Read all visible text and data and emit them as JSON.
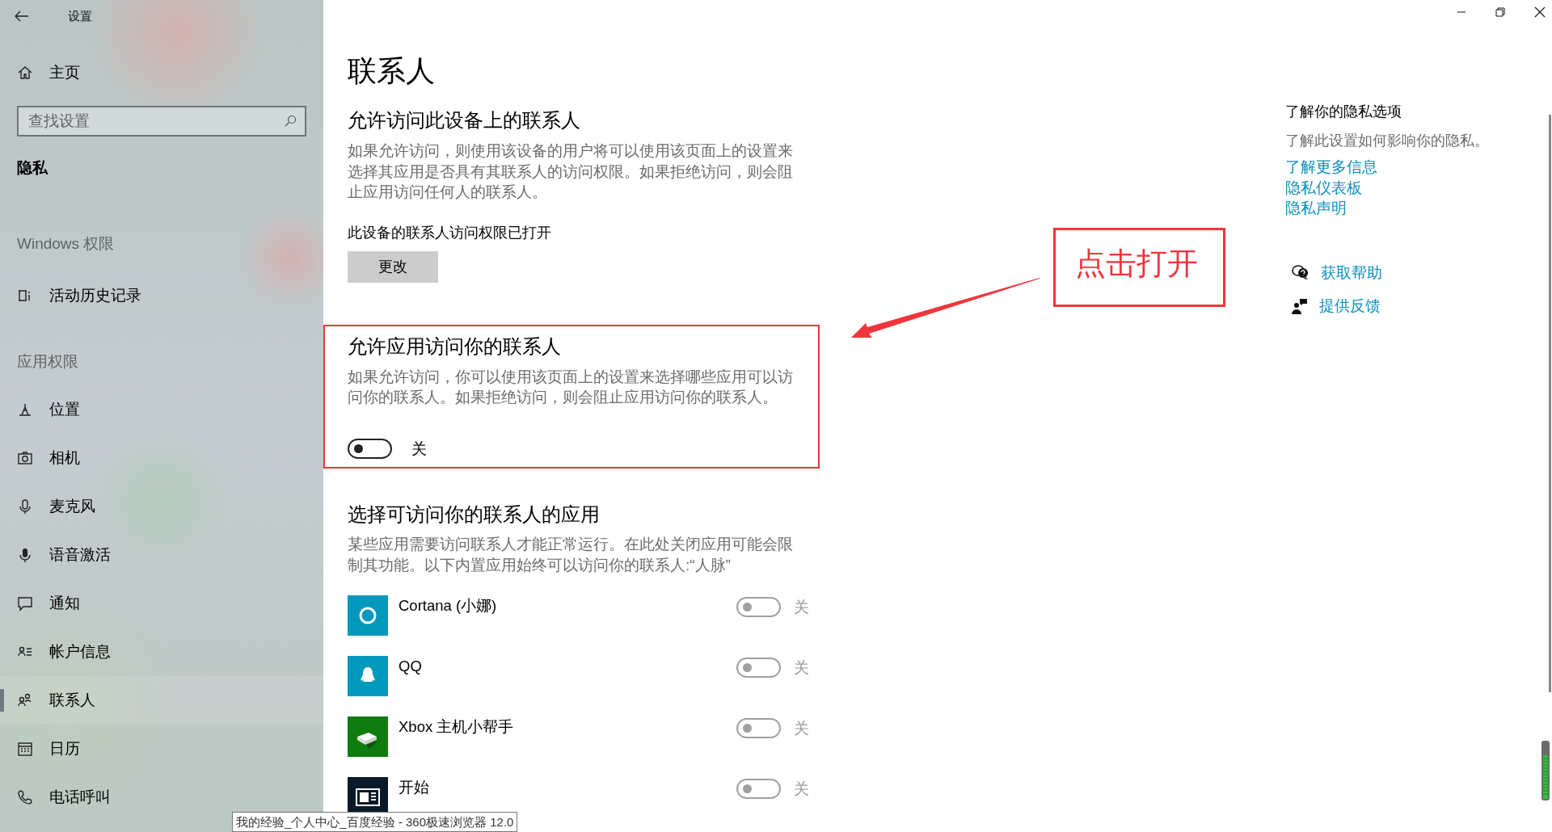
{
  "window": {
    "title": "设置"
  },
  "sidebar": {
    "home": "主页",
    "search": {
      "placeholder": "查找设置"
    },
    "section_title": "隐私",
    "groups": [
      {
        "heading": "Windows 权限",
        "items": [
          {
            "label": "活动历史记录",
            "kind": "activity",
            "selected": false
          }
        ]
      },
      {
        "heading": "应用权限",
        "items": [
          {
            "label": "位置",
            "kind": "location",
            "selected": false
          },
          {
            "label": "相机",
            "kind": "camera",
            "selected": false
          },
          {
            "label": "麦克风",
            "kind": "mic",
            "selected": false
          },
          {
            "label": "语音激活",
            "kind": "voice",
            "selected": false
          },
          {
            "label": "通知",
            "kind": "notification",
            "selected": false
          },
          {
            "label": "帐户信息",
            "kind": "account",
            "selected": false
          },
          {
            "label": "联系人",
            "kind": "contacts",
            "selected": true
          },
          {
            "label": "日历",
            "kind": "calendar",
            "selected": false
          },
          {
            "label": "电话呼叫",
            "kind": "phone",
            "selected": false
          }
        ]
      }
    ]
  },
  "page": {
    "title": "联系人",
    "device_access": {
      "heading": "允许访问此设备上的联系人",
      "description": "如果允许访问，则使用该设备的用户将可以使用该页面上的设置来选择其应用是否具有其联系人的访问权限。如果拒绝访问，则会阻止应用访问任何人的联系人。",
      "status": "此设备的联系人访问权限已打开",
      "button": "更改"
    },
    "app_access": {
      "heading": "允许应用访问你的联系人",
      "description": "如果允许访问，你可以使用该页面上的设置来选择哪些应用可以访问你的联系人。如果拒绝访问，则会阻止应用访问你的联系人。",
      "toggle": {
        "on": false,
        "state_label": "关"
      }
    },
    "app_list": {
      "heading": "选择可访问你的联系人的应用",
      "description": "某些应用需要访问联系人才能正常运行。在此处关闭应用可能会限制其功能。以下内置应用始终可以访问你的联系人:“人脉”",
      "apps": [
        {
          "name": "Cortana (小娜)",
          "kind": "cortana",
          "on": false,
          "disabled": true,
          "state_label": "关"
        },
        {
          "name": "QQ",
          "kind": "qq",
          "on": false,
          "disabled": true,
          "state_label": "关"
        },
        {
          "name": "Xbox 主机小帮手",
          "kind": "xbox",
          "on": false,
          "disabled": true,
          "state_label": "关"
        },
        {
          "name": "开始",
          "kind": "start",
          "on": false,
          "disabled": true,
          "state_label": "关"
        }
      ]
    }
  },
  "side_panel": {
    "heading": "了解你的隐私选项",
    "description": "了解此设置如何影响你的隐私。",
    "links": [
      "了解更多信息",
      "隐私仪表板",
      "隐私声明"
    ],
    "support": [
      {
        "kind": "help",
        "label": "获取帮助"
      },
      {
        "kind": "feedback",
        "label": "提供反馈"
      }
    ]
  },
  "annotation": {
    "label": "点击打开"
  },
  "tooltip": "我的经验_个人中心_百度经验 - 360极速浏览器 12.0"
}
